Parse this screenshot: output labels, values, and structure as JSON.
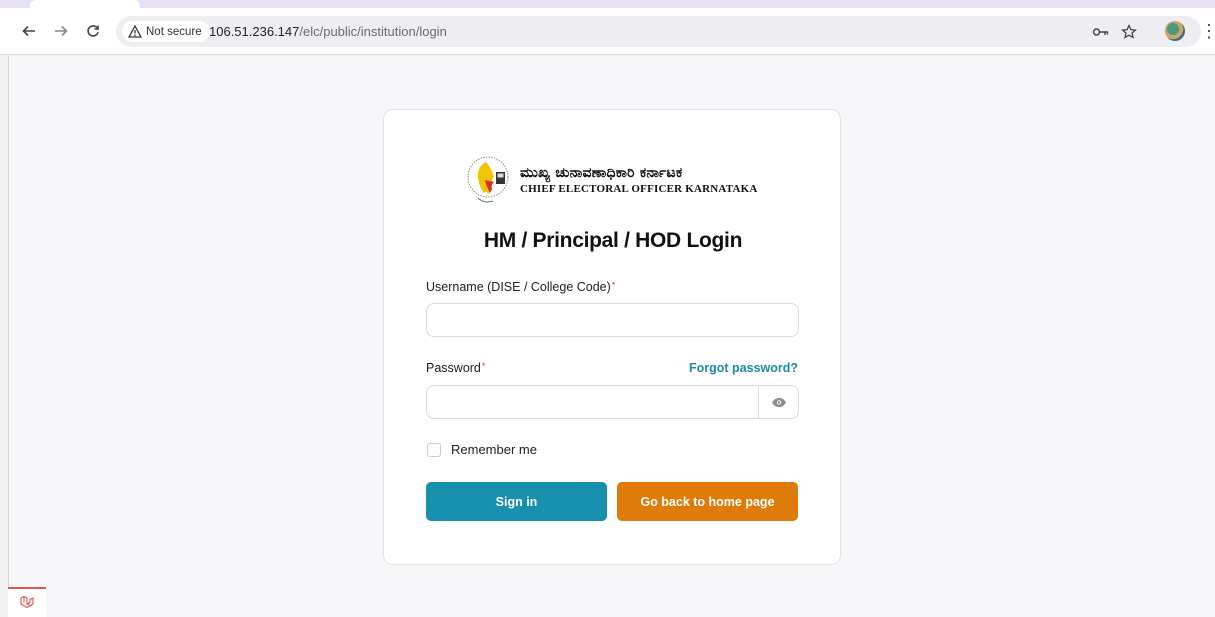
{
  "browser": {
    "security_label": "Not secure",
    "url_host": "106.51.236.147",
    "url_path": "/elc/public/institution/login"
  },
  "logo": {
    "kannada_text": "ಮುಖ್ಯ ಚುನಾವಣಾಧಿಕಾರಿ ಕರ್ನಾಟಕ",
    "english_text": "CHIEF ELECTORAL OFFICER KARNATAKA"
  },
  "form": {
    "title": "HM / Principal / HOD Login",
    "username_label": "Username (DISE / College Code)",
    "username_value": "",
    "password_label": "Password",
    "password_value": "",
    "required_marker": "*",
    "forgot_link": "Forgot password?",
    "remember_label": "Remember me",
    "signin_button": "Sign in",
    "home_button": "Go back to home page"
  },
  "colors": {
    "primary_button": "#1790ad",
    "secondary_button": "#df7b09",
    "link": "#1e88b0",
    "required": "#e53935"
  },
  "icons": {
    "back": "back-arrow-icon",
    "forward": "forward-arrow-icon",
    "reload": "reload-icon",
    "warning": "warning-icon",
    "password_key": "key-icon",
    "bookmark": "star-icon",
    "menu": "more-vert-icon",
    "show_password": "eye-icon",
    "framework": "laravel-icon"
  }
}
